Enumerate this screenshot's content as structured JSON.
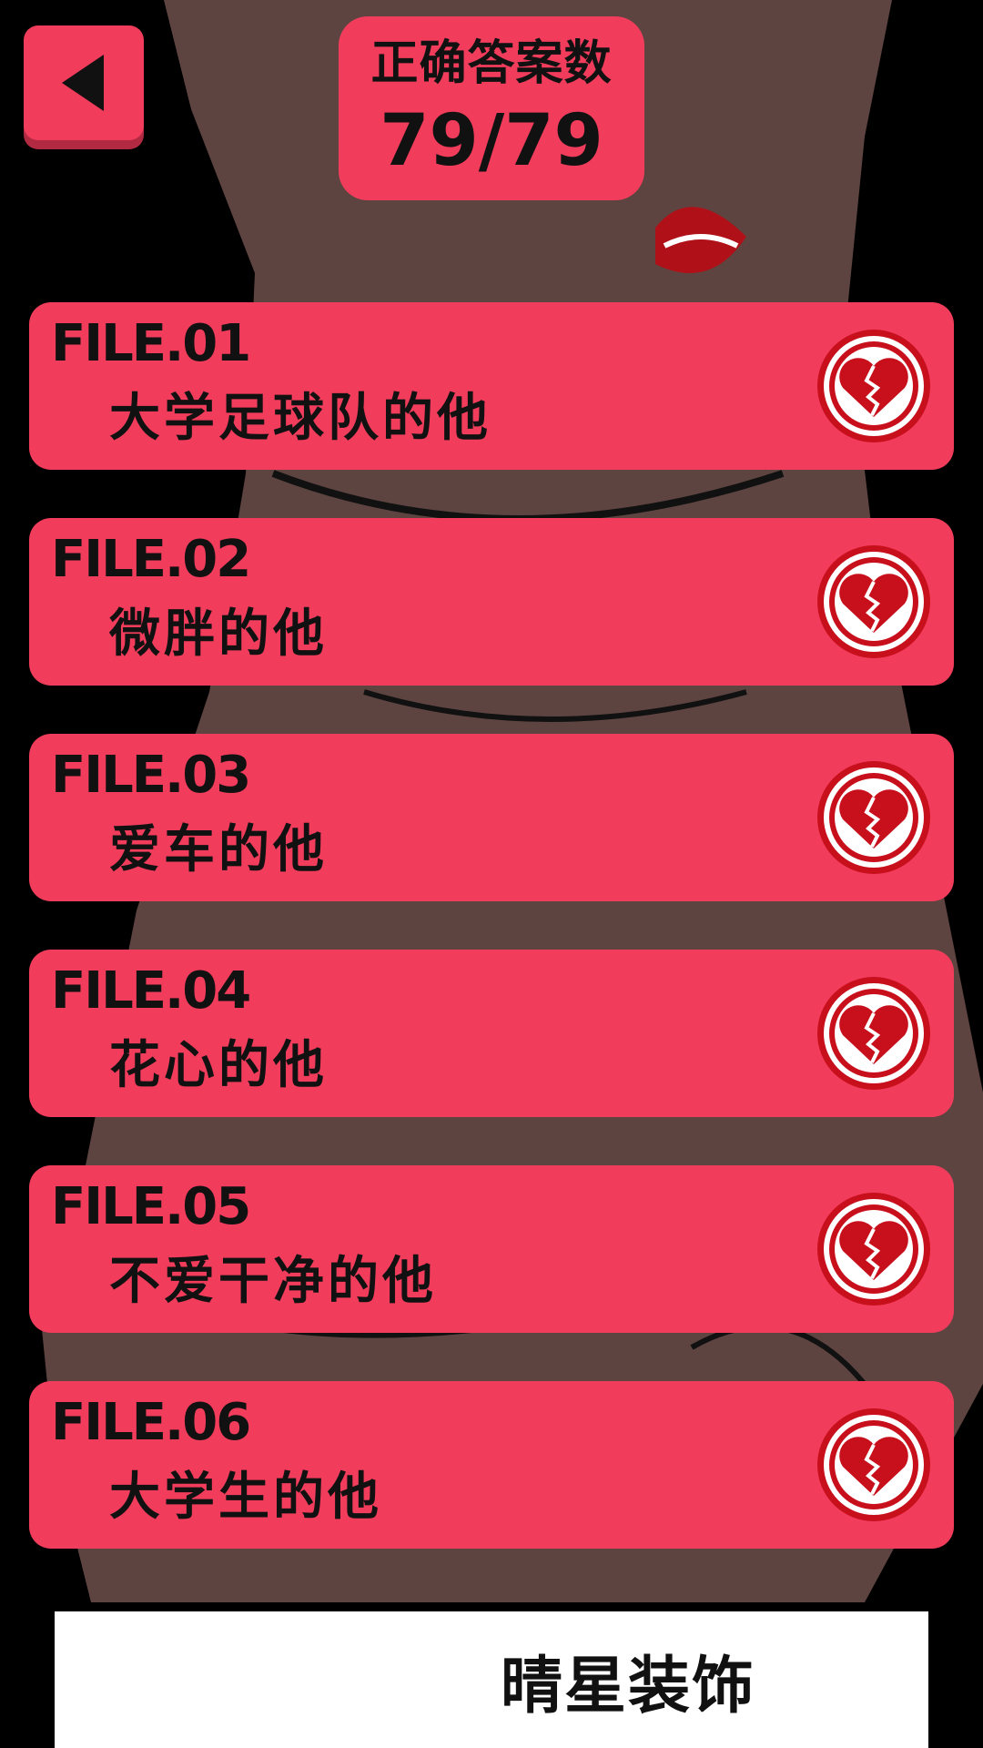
{
  "header": {
    "score_label": "正确答案数",
    "score_value": "79/79"
  },
  "files": [
    {
      "code": "FILE.01",
      "name": "大学足球队的他",
      "icon": "broken-heart-icon"
    },
    {
      "code": "FILE.02",
      "name": "微胖的他",
      "icon": "broken-heart-icon"
    },
    {
      "code": "FILE.03",
      "name": "爱车的他",
      "icon": "broken-heart-icon"
    },
    {
      "code": "FILE.04",
      "name": "花心的他",
      "icon": "broken-heart-icon"
    },
    {
      "code": "FILE.05",
      "name": "不爱干净的他",
      "icon": "broken-heart-icon"
    },
    {
      "code": "FILE.06",
      "name": "大学生的他",
      "icon": "broken-heart-icon"
    }
  ],
  "banner": {
    "text": "晴星装饰"
  },
  "colors": {
    "accent": "#f23c5c",
    "accent_shadow": "#b22a42",
    "heart": "#c8101c",
    "background_skin": "#5e4440"
  }
}
